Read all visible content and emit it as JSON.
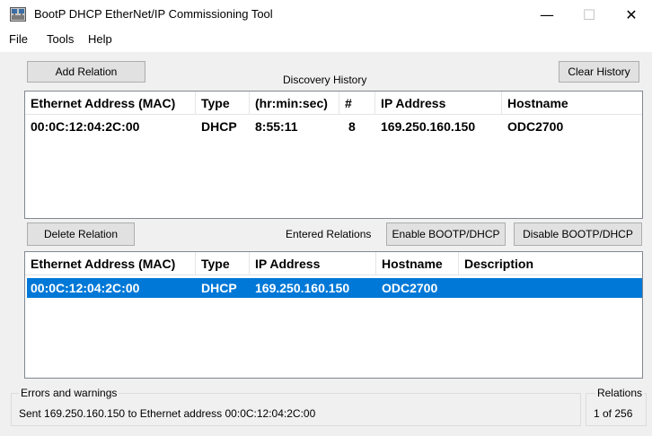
{
  "window": {
    "title": "BootP DHCP EtherNet/IP Commissioning Tool",
    "minimize": "—",
    "maximize": "☐",
    "close": "✕"
  },
  "menu": [
    "File",
    "Tools",
    "Help"
  ],
  "discovery": {
    "add_button": "Add Relation",
    "label": "Discovery History",
    "clear_button": "Clear History",
    "columns": [
      "Ethernet Address (MAC)",
      "Type",
      "(hr:min:sec)",
      "#",
      "IP Address",
      "Hostname"
    ],
    "rows": [
      {
        "mac": "00:0C:12:04:2C:00",
        "type": "DHCP",
        "time": "8:55:11",
        "count": "8",
        "ip": "169.250.160.150",
        "hostname": "ODC2700"
      }
    ]
  },
  "relations": {
    "delete_button": "Delete Relation",
    "label": "Entered Relations",
    "enable_button": "Enable BOOTP/DHCP",
    "disable_button": "Disable BOOTP/DHCP",
    "columns": [
      "Ethernet Address (MAC)",
      "Type",
      "IP Address",
      "Hostname",
      "Description"
    ],
    "rows": [
      {
        "mac": "00:0C:12:04:2C:00",
        "type": "DHCP",
        "ip": "169.250.160.150",
        "hostname": "ODC2700",
        "description": ""
      }
    ]
  },
  "status": {
    "errors_title": "Errors and warnings",
    "message": "Sent 169.250.160.150 to Ethernet address 00:0C:12:04:2C:00",
    "relations_title": "Relations",
    "relations_count": "1 of 256"
  },
  "colors": {
    "selection": "#0078d7",
    "client_bg": "#f0f0f0",
    "button_bg": "#e1e1e1"
  },
  "icons": {
    "app": "network-tool-icon"
  }
}
